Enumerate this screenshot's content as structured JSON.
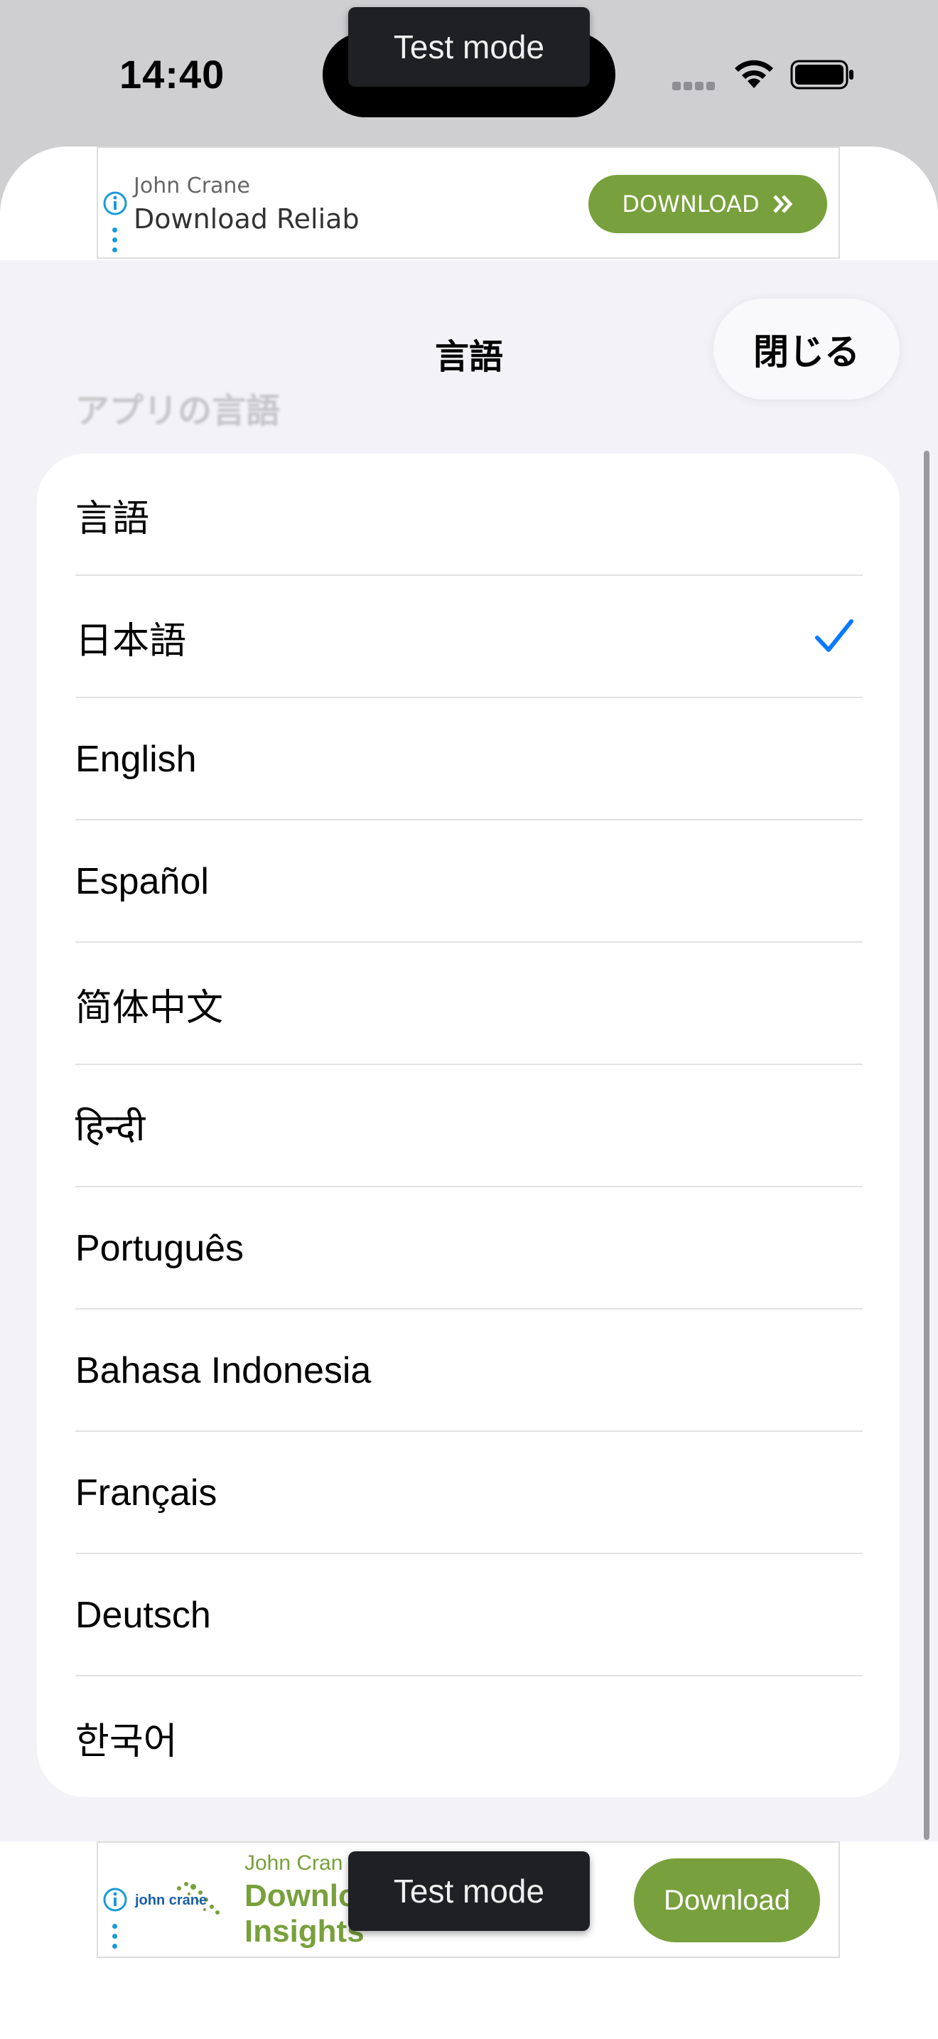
{
  "status_bar": {
    "time": "14:40"
  },
  "ad_top": {
    "advertiser": "John Crane",
    "headline": "Download Reliab",
    "button_label": "DOWNLOAD",
    "test_mode": "Test mode"
  },
  "sheet": {
    "title": "言語",
    "close_label": "閉じる",
    "section_header": "アプリの言語"
  },
  "languages": {
    "header": "言語",
    "items": [
      {
        "label": "日本語",
        "selected": true
      },
      {
        "label": "English",
        "selected": false
      },
      {
        "label": "Español",
        "selected": false
      },
      {
        "label": "简体中文",
        "selected": false
      },
      {
        "label": "हिन्दी",
        "selected": false
      },
      {
        "label": "Português",
        "selected": false
      },
      {
        "label": "Bahasa Indonesia",
        "selected": false
      },
      {
        "label": "Français",
        "selected": false
      },
      {
        "label": "Deutsch",
        "selected": false
      },
      {
        "label": "한국어",
        "selected": false
      }
    ]
  },
  "ad_bottom": {
    "logo_text": "john crane",
    "advertiser": "John Cran",
    "headline_line1": "Downlo",
    "headline_line2": "Insights",
    "button_label": "Download",
    "test_mode": "Test mode"
  },
  "colors": {
    "accent": "#0a7aff",
    "ad_green": "#78a03c",
    "ad_info_blue": "#1a9ad6",
    "sheet_background": "#f2f2f7"
  }
}
